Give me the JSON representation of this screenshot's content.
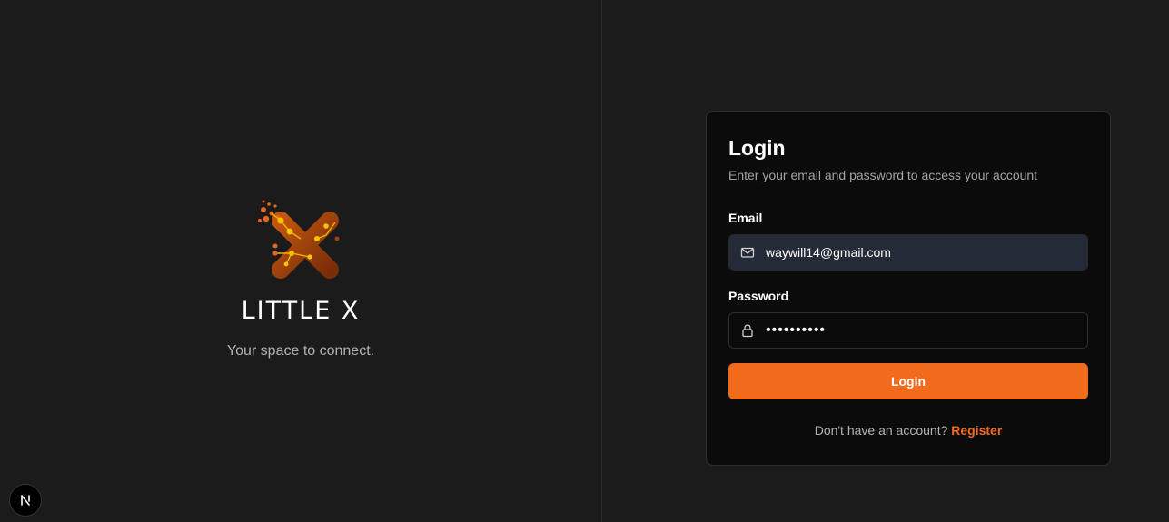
{
  "brand": {
    "name": "LITTLE X",
    "tagline": "Your space to connect."
  },
  "login": {
    "title": "Login",
    "subtitle": "Enter your email and password to access your account",
    "email_label": "Email",
    "email_value": "waywill14@gmail.com",
    "password_label": "Password",
    "password_value": "••••••••••",
    "submit_label": "Login",
    "register_prompt": "Don't have an account?",
    "register_link": "Register"
  },
  "colors": {
    "accent": "#f26a1b",
    "background": "#1b1b1b",
    "card": "#0b0b0b",
    "email_field": "#242a36"
  },
  "icons": {
    "email": "mail-icon",
    "password": "lock-icon",
    "dev_badge": "nextjs-icon"
  }
}
